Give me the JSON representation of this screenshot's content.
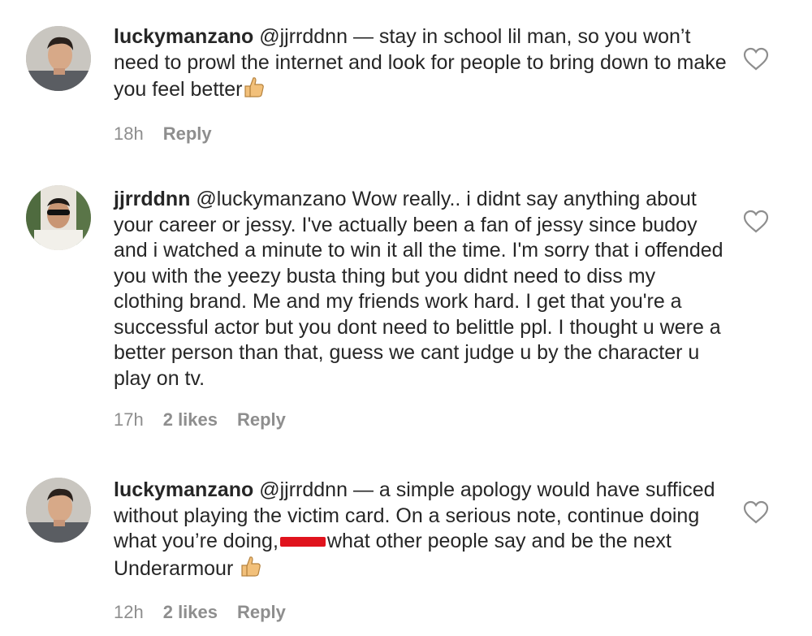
{
  "comments": [
    {
      "username": "luckymanzano",
      "mention": "@jjrrddnn",
      "text": "— stay in school lil man, so you won’t need to prowl the internet and look for people to bring down to make you feel better",
      "emoji": "thumbs-up-icon",
      "time": "18h",
      "likes": "",
      "reply": "Reply",
      "icon": "heart-icon"
    },
    {
      "username": "jjrrddnn",
      "mention": "@luckymanzano",
      "text": "Wow really.. i didnt say anything about your career or jessy. I've actually been a fan of jessy since budoy and i watched a minute to win it all the time. I'm sorry that i offended you with the yeezy busta thing but you didnt need to diss my clothing brand. Me and my friends work hard. I get that you're a successful actor but you dont need to belittle ppl. I thought u were a better person than that, guess we cant judge u by the character u play on tv.",
      "time": "17h",
      "likes": "2 likes",
      "reply": "Reply",
      "icon": "heart-icon"
    },
    {
      "username": "luckymanzano",
      "mention": "@jjrrddnn",
      "text_before": "— a simple apology would have sufficed without playing the victim card. On a serious note, continue doing what you’re doing,",
      "text_after": "what other people say and be the next Underarmour",
      "redaction_color": "#e0131d",
      "emoji": "thumbs-up-icon",
      "time": "12h",
      "likes": "2 likes",
      "reply": "Reply",
      "icon": "heart-icon"
    }
  ]
}
